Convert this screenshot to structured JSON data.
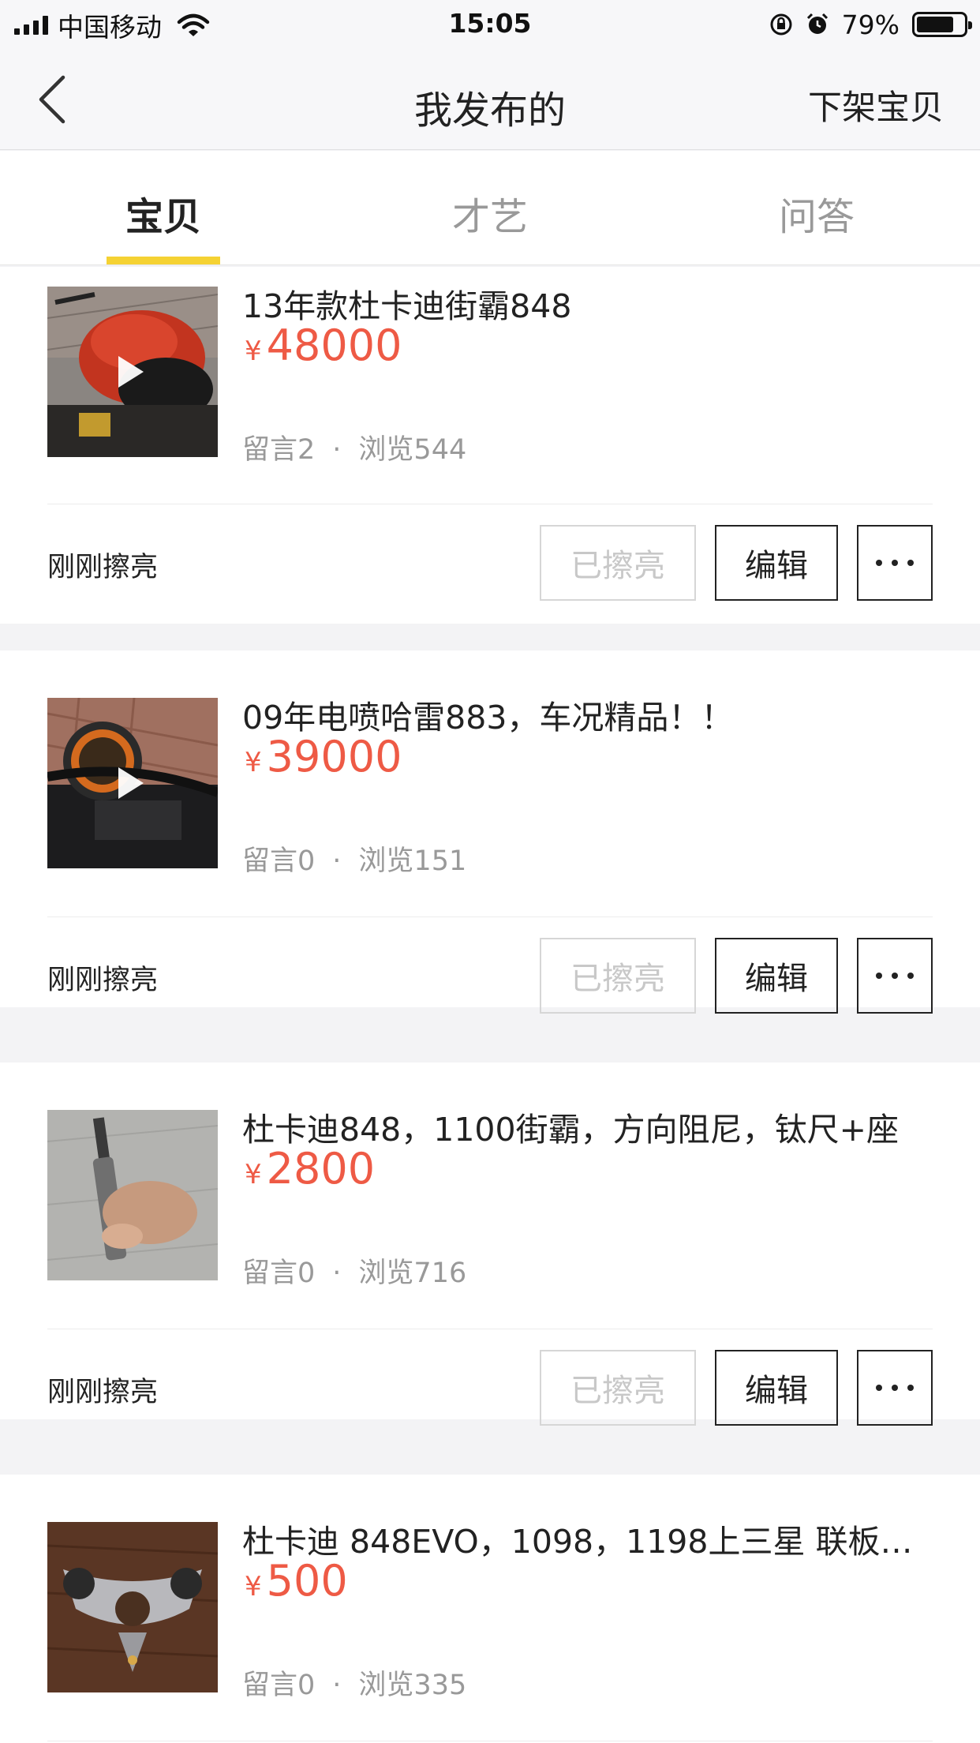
{
  "status_bar": {
    "carrier": "中国移动",
    "time": "15:05",
    "battery_percent": "79%",
    "battery_level": 0.79
  },
  "nav": {
    "title": "我发布的",
    "action": "下架宝贝",
    "back_icon": "chevron-left-icon"
  },
  "tabs": [
    {
      "label": "宝贝",
      "active": true
    },
    {
      "label": "才艺",
      "active": false
    },
    {
      "label": "问答",
      "active": false
    }
  ],
  "items": [
    {
      "title": "13年款杜卡迪街霸848",
      "currency": "¥",
      "price": "48000",
      "comments_label": "留言2",
      "dot": "·",
      "views_label": "浏览544",
      "refresh_status": "刚刚擦亮",
      "polished_label": "已擦亮",
      "edit_label": "编辑",
      "has_video": true
    },
    {
      "title": "09年电喷哈雷883，车况精品！！",
      "currency": "¥",
      "price": "39000",
      "comments_label": "留言0",
      "dot": "·",
      "views_label": "浏览151",
      "refresh_status": "刚刚擦亮",
      "polished_label": "已擦亮",
      "edit_label": "编辑",
      "has_video": true
    },
    {
      "title": "杜卡迪848，1100街霸，方向阻尼，钛尺+座",
      "currency": "¥",
      "price": "2800",
      "comments_label": "留言0",
      "dot": "·",
      "views_label": "浏览716",
      "refresh_status": "刚刚擦亮",
      "polished_label": "已擦亮",
      "edit_label": "编辑",
      "has_video": false
    },
    {
      "title": "杜卡迪 848EVO，1098，1198上三星 联板…",
      "currency": "¥",
      "price": "500",
      "comments_label": "留言0",
      "dot": "·",
      "views_label": "浏览335",
      "has_video": false
    }
  ],
  "colors": {
    "accent_yellow": "#f5d233",
    "price_red": "#ee5a45",
    "muted_gray": "#999999"
  }
}
